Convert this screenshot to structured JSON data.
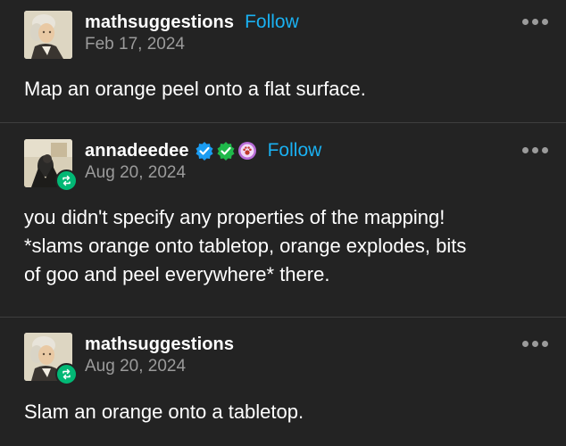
{
  "posts": [
    {
      "username": "mathsuggestions",
      "follow_label": "Follow",
      "date": "Feb 17, 2024",
      "body": "Map an orange peel onto a flat surface."
    },
    {
      "username": "annadeedee",
      "follow_label": "Follow",
      "date": "Aug 20, 2024",
      "body_lines": [
        "you didn't specify any properties of the mapping!",
        "*slams orange onto tabletop, orange explodes, bits",
        "of goo and peel everywhere* there."
      ],
      "badges": [
        "blue-verified-badge-icon",
        "green-verified-badge-icon",
        "purple-paw-badge-icon"
      ]
    },
    {
      "username": "mathsuggestions",
      "date": "Aug 20, 2024",
      "body": "Slam an orange onto a tabletop."
    }
  ],
  "colors": {
    "background": "#232323",
    "follow": "#1ab1f2",
    "muted": "#9b9b9b",
    "reblog_green": "#02b875"
  }
}
